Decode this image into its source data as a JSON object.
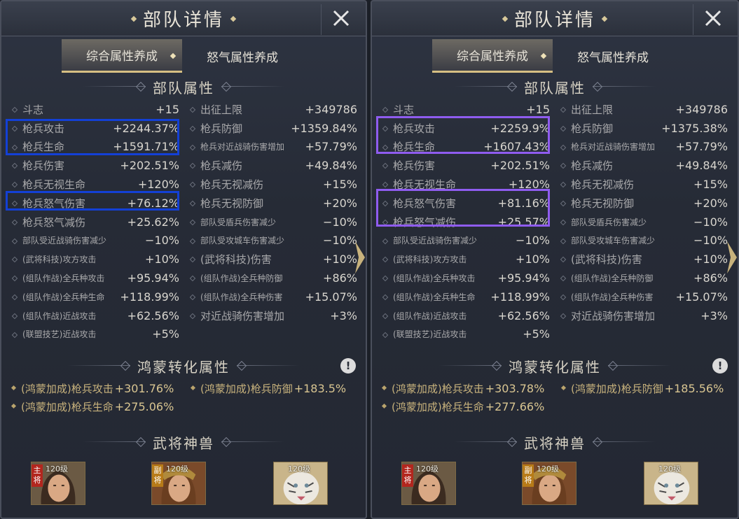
{
  "colors": {
    "highlight_left": "#1340d6",
    "highlight_right": "#8f5cf0",
    "gold_text": "#c8b27c"
  },
  "panels": [
    {
      "title": "部队详情",
      "tabs": [
        "综合属性养成",
        "怒气属性养成"
      ],
      "section_attr": "部队属性",
      "col1": [
        {
          "label": "斗志",
          "value": "+15"
        },
        {
          "label": "枪兵攻击",
          "value": "+2244.37%"
        },
        {
          "label": "枪兵生命",
          "value": "+1591.71%"
        },
        {
          "label": "枪兵伤害",
          "value": "+202.51%"
        },
        {
          "label": "枪兵无视生命",
          "value": "+120%"
        },
        {
          "label": "枪兵怒气伤害",
          "value": "+76.12%"
        },
        {
          "label": "枪兵怒气减伤",
          "value": "+25.62%"
        },
        {
          "label": "部队受近战骑伤害减少",
          "value": "−10%"
        },
        {
          "label": "(武将科技)攻方攻击",
          "value": "+10%"
        },
        {
          "label": "(组队作战)全兵种攻击",
          "value": "+95.94%"
        },
        {
          "label": "(组队作战)全兵种生命",
          "value": "+118.99%"
        },
        {
          "label": "(组队作战)近战攻击",
          "value": "+62.56%"
        },
        {
          "label": "(联盟技艺)近战攻击",
          "value": "+5%"
        }
      ],
      "col2": [
        {
          "label": "出征上限",
          "value": "+349786"
        },
        {
          "label": "枪兵防御",
          "value": "+1359.84%"
        },
        {
          "label": "枪兵对近战骑伤害增加",
          "value": "+57.79%"
        },
        {
          "label": "枪兵减伤",
          "value": "+49.84%"
        },
        {
          "label": "枪兵无视减伤",
          "value": "+15%"
        },
        {
          "label": "枪兵无视防御",
          "value": "+20%"
        },
        {
          "label": "部队受盾兵伤害减少",
          "value": "−10%"
        },
        {
          "label": "部队受攻城车伤害减少",
          "value": "−10%"
        },
        {
          "label": "(武将科技)伤害",
          "value": "+10%"
        },
        {
          "label": "(组队作战)全兵种防御",
          "value": "+86%"
        },
        {
          "label": "(组队作战)全兵种伤害",
          "value": "+15.07%"
        },
        {
          "label": "对近战骑伤害增加",
          "value": "+3%"
        }
      ],
      "section_hm": "鸿蒙转化属性",
      "hm_warn": "!",
      "hm": [
        {
          "label": "(鸿蒙加成)枪兵攻击",
          "value": "+301.76%"
        },
        {
          "label": "(鸿蒙加成)枪兵防御",
          "value": "+183.5%"
        },
        {
          "label": "(鸿蒙加成)枪兵生命",
          "value": "+275.06%"
        }
      ],
      "section_ws": "武将神兽",
      "cards": [
        {
          "level": "120级",
          "role": "主将",
          "icon": "hero-portrait-icon"
        },
        {
          "level": "120级",
          "role": "副将",
          "icon": "hero-portrait-icon"
        },
        {
          "level": "120级",
          "role": "",
          "icon": "white-tiger-icon"
        }
      ]
    },
    {
      "title": "部队详情",
      "tabs": [
        "综合属性养成",
        "怒气属性养成"
      ],
      "section_attr": "部队属性",
      "col1": [
        {
          "label": "斗志",
          "value": "+15"
        },
        {
          "label": "枪兵攻击",
          "value": "+2259.9%"
        },
        {
          "label": "枪兵生命",
          "value": "+1607.43%"
        },
        {
          "label": "枪兵伤害",
          "value": "+202.51%"
        },
        {
          "label": "枪兵无视生命",
          "value": "+120%"
        },
        {
          "label": "枪兵怒气伤害",
          "value": "+81.16%"
        },
        {
          "label": "枪兵怒气减伤",
          "value": "+25.57%"
        },
        {
          "label": "部队受近战骑伤害减少",
          "value": "−10%"
        },
        {
          "label": "(武将科技)攻方攻击",
          "value": "+10%"
        },
        {
          "label": "(组队作战)全兵种攻击",
          "value": "+95.94%"
        },
        {
          "label": "(组队作战)全兵种生命",
          "value": "+118.99%"
        },
        {
          "label": "(组队作战)近战攻击",
          "value": "+62.56%"
        },
        {
          "label": "(联盟技艺)近战攻击",
          "value": "+5%"
        }
      ],
      "col2": [
        {
          "label": "出征上限",
          "value": "+349786"
        },
        {
          "label": "枪兵防御",
          "value": "+1375.38%"
        },
        {
          "label": "枪兵对近战骑伤害增加",
          "value": "+57.79%"
        },
        {
          "label": "枪兵减伤",
          "value": "+49.84%"
        },
        {
          "label": "枪兵无视减伤",
          "value": "+15%"
        },
        {
          "label": "枪兵无视防御",
          "value": "+20%"
        },
        {
          "label": "部队受盾兵伤害减少",
          "value": "−10%"
        },
        {
          "label": "部队受攻城车伤害减少",
          "value": "−10%"
        },
        {
          "label": "(武将科技)伤害",
          "value": "+10%"
        },
        {
          "label": "(组队作战)全兵种防御",
          "value": "+86%"
        },
        {
          "label": "(组队作战)全兵种伤害",
          "value": "+15.07%"
        },
        {
          "label": "对近战骑伤害增加",
          "value": "+3%"
        }
      ],
      "section_hm": "鸿蒙转化属性",
      "hm_warn": "!",
      "hm": [
        {
          "label": "(鸿蒙加成)枪兵攻击",
          "value": "+303.78%"
        },
        {
          "label": "(鸿蒙加成)枪兵防御",
          "value": "+185.56%"
        },
        {
          "label": "(鸿蒙加成)枪兵生命",
          "value": "+277.66%"
        }
      ],
      "section_ws": "武将神兽",
      "cards": [
        {
          "level": "120级",
          "role": "主将",
          "icon": "hero-portrait-icon"
        },
        {
          "level": "120级",
          "role": "副将",
          "icon": "hero-portrait-icon"
        },
        {
          "level": "120级",
          "role": "",
          "icon": "white-tiger-icon"
        }
      ]
    }
  ]
}
